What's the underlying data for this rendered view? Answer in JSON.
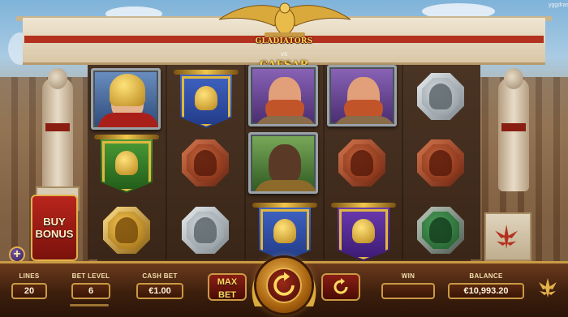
{
  "game": {
    "title_line1": "GLADIATORS",
    "title_vs": "VS",
    "title_line2": "CAESAR",
    "corner_tag": "yggdrasil"
  },
  "reels": {
    "columns": [
      [
        "portrait-female-gladiator",
        "banner-green-centaur",
        "coin-gold-helmet"
      ],
      [
        "banner-blue-helmet",
        "coin-red-helmet",
        "coin-silver-helmet"
      ],
      [
        "portrait-red-beard-warrior",
        "portrait-dark-warrior",
        "banner-blue-helmet"
      ],
      [
        "portrait-red-beard-warrior",
        "coin-red-helmet",
        "banner-purple-ram"
      ],
      [
        "coin-silver-helmet",
        "coin-red-helmet",
        "coin-green-helmet"
      ]
    ]
  },
  "buy_bonus": {
    "label": "BUY\nBONUS"
  },
  "controls": {
    "lines_label": "LINES",
    "lines_value": "20",
    "bet_level_label": "BET LEVEL",
    "bet_level_value": "6",
    "cash_bet_label": "CASH BET",
    "cash_bet_value": "€1.00",
    "max_bet_line1": "MAX",
    "max_bet_line2": "BET",
    "win_label": "WIN",
    "win_value": "",
    "balance_label": "BALANCE",
    "balance_value": "€10,993.20"
  },
  "colors": {
    "accent_gold": "#c99a44",
    "panel_brown": "#3d1f0d",
    "button_red": "#8a1e14"
  },
  "icons": {
    "spin": "spin-icon",
    "autoplay": "autoplay-icon",
    "menu": "laurel-menu-icon",
    "plus": "plus-icon"
  }
}
